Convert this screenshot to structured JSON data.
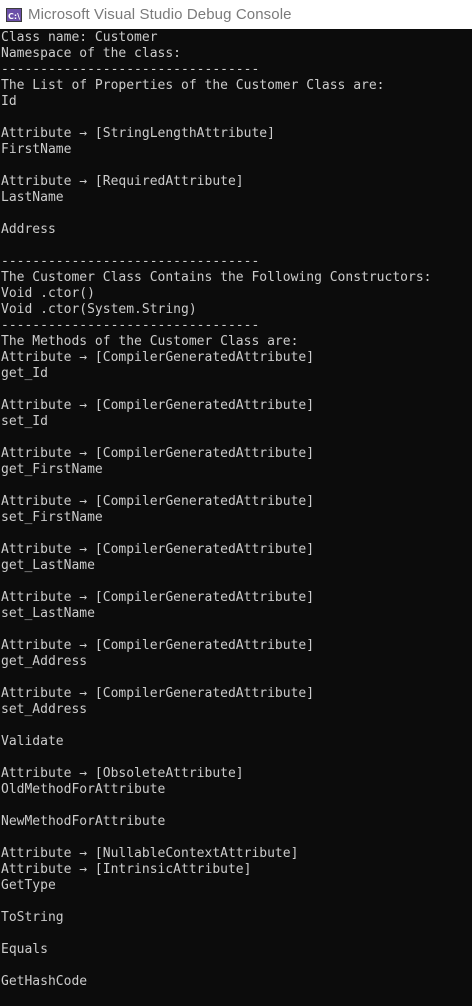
{
  "window": {
    "title": "Microsoft Visual Studio Debug Console",
    "icon": "console-app-icon"
  },
  "console": {
    "lines": [
      "Class name: Customer",
      "Namespace of the class:",
      "---------------------------------",
      "The List of Properties of the Customer Class are:",
      "Id",
      "",
      "Attribute → [StringLengthAttribute]",
      "FirstName",
      "",
      "Attribute → [RequiredAttribute]",
      "LastName",
      "",
      "Address",
      "",
      "---------------------------------",
      "The Customer Class Contains the Following Constructors:",
      "Void .ctor()",
      "Void .ctor(System.String)",
      "---------------------------------",
      "The Methods of the Customer Class are:",
      "Attribute → [CompilerGeneratedAttribute]",
      "get_Id",
      "",
      "Attribute → [CompilerGeneratedAttribute]",
      "set_Id",
      "",
      "Attribute → [CompilerGeneratedAttribute]",
      "get_FirstName",
      "",
      "Attribute → [CompilerGeneratedAttribute]",
      "set_FirstName",
      "",
      "Attribute → [CompilerGeneratedAttribute]",
      "get_LastName",
      "",
      "Attribute → [CompilerGeneratedAttribute]",
      "set_LastName",
      "",
      "Attribute → [CompilerGeneratedAttribute]",
      "get_Address",
      "",
      "Attribute → [CompilerGeneratedAttribute]",
      "set_Address",
      "",
      "Validate",
      "",
      "Attribute → [ObsoleteAttribute]",
      "OldMethodForAttribute",
      "",
      "NewMethodForAttribute",
      "",
      "Attribute → [NullableContextAttribute]",
      "Attribute → [IntrinsicAttribute]",
      "GetType",
      "",
      "ToString",
      "",
      "Equals",
      "",
      "GetHashCode"
    ]
  }
}
